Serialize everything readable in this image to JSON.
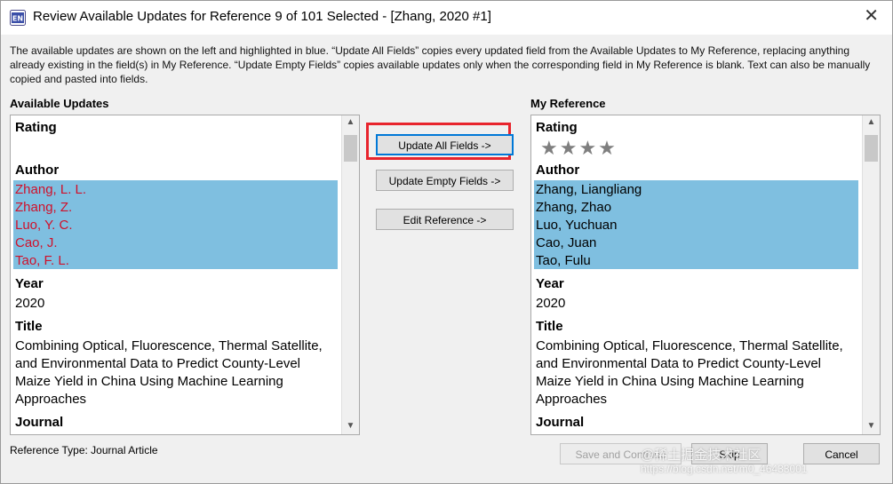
{
  "window": {
    "title": "Review Available Updates for Reference 9 of 101 Selected - [Zhang, 2020 #1]",
    "close_glyph": "✕",
    "app_icon": "endnote-icon"
  },
  "description": "The available updates are shown on the left and highlighted in blue. “Update All Fields” copies every updated field from the Available Updates to My Reference, replacing anything already existing in the field(s) in My Reference. “Update Empty Fields” copies available updates only when the corresponding field in My Reference is blank. Text can also be manually copied and pasted into fields.",
  "left": {
    "header": "Available Updates",
    "rating_label": "Rating",
    "author_label": "Author",
    "authors": [
      "Zhang, L. L.",
      "Zhang, Z.",
      "Luo, Y. C.",
      "Cao, J.",
      "Tao, F. L."
    ],
    "year_label": "Year",
    "year": "2020",
    "title_label": "Title",
    "title": "Combining Optical, Fluorescence, Thermal Satellite, and Environmental Data to Predict County-Level Maize Yield in China Using Machine Learning Approaches",
    "journal_label": "Journal"
  },
  "right": {
    "header": "My Reference",
    "rating_label": "Rating",
    "rating_stars": "★★★★",
    "rating_value": 4,
    "author_label": "Author",
    "authors": [
      "Zhang, Liangliang",
      "Zhang, Zhao",
      "Luo, Yuchuan",
      "Cao, Juan",
      "Tao, Fulu"
    ],
    "year_label": "Year",
    "year": "2020",
    "title_label": "Title",
    "title": "Combining Optical, Fluorescence, Thermal Satellite, and Environmental Data to Predict County-Level Maize Yield in China Using Machine Learning Approaches",
    "journal_label": "Journal"
  },
  "buttons": {
    "update_all": "Update All Fields ->",
    "update_empty": "Update Empty Fields ->",
    "edit_reference": "Edit Reference ->",
    "save_continue": "Save and Continue",
    "skip": "Skip",
    "cancel": "Cancel"
  },
  "reference_type": "Reference Type: Journal Article",
  "colors": {
    "highlight": "#7fbfe0",
    "updated_text": "#d0102a",
    "annotation_border": "#e8242d"
  },
  "watermark": {
    "line1": "@稀土掘金技术社区",
    "line2": "https://blog.csdn.net/m0_46433001"
  }
}
